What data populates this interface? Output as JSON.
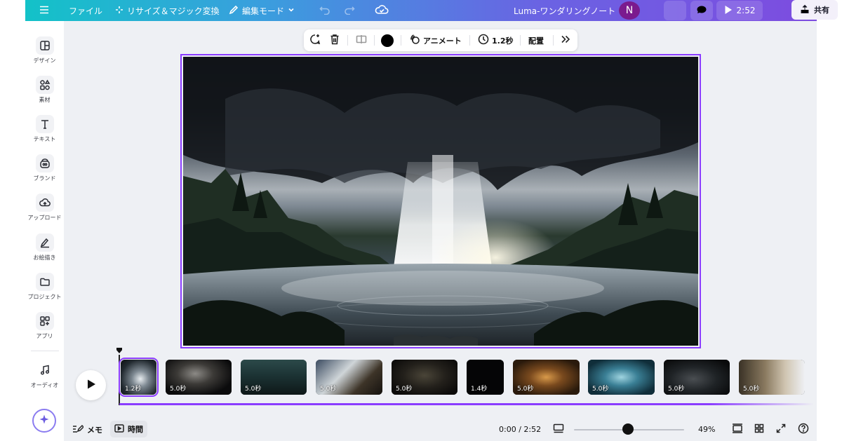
{
  "colors": {
    "accent": "#8b3dff",
    "topbar_start": "#13c2c8",
    "topbar_end": "#7d4ce0",
    "avatar": "#7b1a8e"
  },
  "topbar": {
    "menu_icon": "hamburger-icon",
    "file_label": "ファイル",
    "resize_label": "リサイズ＆マジック変換",
    "edit_mode_label": "編集モード",
    "doc_title": "Luma-ワンダリングノート",
    "avatar_initial": "N",
    "play_time": "2:52",
    "share_label": "共有"
  },
  "sidebar": {
    "items": [
      {
        "label": "デザイン",
        "icon": "design-layout-icon"
      },
      {
        "label": "素材",
        "icon": "elements-shapes-icon"
      },
      {
        "label": "テキスト",
        "icon": "text-icon"
      },
      {
        "label": "ブランド",
        "icon": "brand-icon"
      },
      {
        "label": "アップロード",
        "icon": "upload-cloud-icon"
      },
      {
        "label": "お絵描き",
        "icon": "draw-pen-icon"
      },
      {
        "label": "プロジェクト",
        "icon": "folder-icon"
      },
      {
        "label": "アプリ",
        "icon": "apps-grid-icon"
      },
      {
        "label": "オーディオ",
        "icon": "music-note-icon"
      }
    ]
  },
  "float_toolbar": {
    "animate_label": "アニメート",
    "duration_label": "1.2秒",
    "arrange_label": "配置",
    "color": "#000000"
  },
  "timeline": {
    "clips": [
      {
        "duration": "1.2秒",
        "selected": true
      },
      {
        "duration": "5.0秒",
        "selected": false
      },
      {
        "duration": "5.0秒",
        "selected": false
      },
      {
        "duration": "5.0秒",
        "selected": false
      },
      {
        "duration": "5.0秒",
        "selected": false
      },
      {
        "duration": "1.4秒",
        "selected": false
      },
      {
        "duration": "5.0秒",
        "selected": false
      },
      {
        "duration": "5.0秒",
        "selected": false
      },
      {
        "duration": "5.0秒",
        "selected": false
      },
      {
        "duration": "5.0秒",
        "selected": false
      }
    ]
  },
  "bottombar": {
    "notes_label": "メモ",
    "time_label": "時間",
    "timecode": "0:00 / 2:52",
    "zoom_percent": "49%",
    "zoom_level": 0.49
  }
}
